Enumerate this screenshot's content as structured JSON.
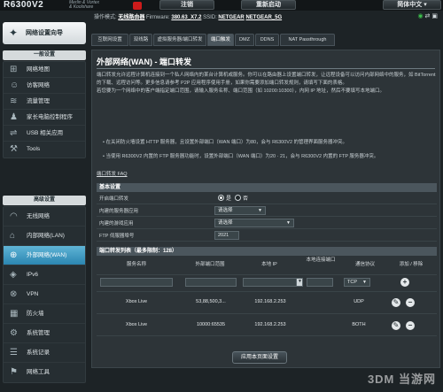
{
  "brand": "R6300V2",
  "header": {
    "mascot_line1": "Merlin & Vortex",
    "mascot_line2": "& Koolshare",
    "btn_logout": "注销",
    "btn_reboot": "重新启动",
    "btn_lang": "简体中文",
    "status_prefix": "操作模式:",
    "mode": "无线路由器",
    "firmware_label": "Firmware:",
    "firmware": "380.63_X7.2",
    "ssid_label": "SSID:",
    "ssid1": "NETGEAR",
    "ssid2": "NETGEAR_5G"
  },
  "sidebar": {
    "quick_setup": "网络设置向导",
    "general_title": "一般设置",
    "general_items": [
      {
        "label": "网络地图",
        "icon": "map-icon"
      },
      {
        "label": "访客网络",
        "icon": "guest-icon"
      },
      {
        "label": "流量管理",
        "icon": "traffic-icon"
      },
      {
        "label": "家长电脑控制程序",
        "icon": "parental-icon"
      },
      {
        "label": "USB 相关应用",
        "icon": "usb-icon"
      },
      {
        "label": "Tools",
        "icon": "tools-icon"
      }
    ],
    "advanced_title": "高级设置",
    "advanced_items": [
      {
        "label": "无线网络",
        "icon": "wifi-icon"
      },
      {
        "label": "内部网络(LAN)",
        "icon": "home-icon"
      },
      {
        "label": "外部网络(WAN)",
        "icon": "globe-icon"
      },
      {
        "label": "IPv6",
        "icon": "ipv6-icon"
      },
      {
        "label": "VPN",
        "icon": "vpn-icon"
      },
      {
        "label": "防火墙",
        "icon": "firewall-icon"
      },
      {
        "label": "系统管理",
        "icon": "admin-icon"
      },
      {
        "label": "系统记录",
        "icon": "log-icon"
      },
      {
        "label": "网络工具",
        "icon": "network-tools-icon"
      }
    ]
  },
  "tabs": [
    "互联网设置",
    "双线路",
    "虚拟服务器/端口转发",
    "端口触发",
    "DMZ",
    "DDNS",
    "NAT Passthrough"
  ],
  "page": {
    "title": "外部网络(WAN) - 端口转发",
    "desc": "端口转发允许远程计算机连接到一个私人网络内的某台计算机或服务。你可以在路由器上设置端口转发，让远程设备可以访问内部网络中的服务，如 BitTorrent 的下载、远程访问等。更多信息请参考 P2P 应用程序使用手册，如果你需要添加端口转发规则，请填写下面的表格。",
    "desc2": "若您要为一个网络中的客户端指定端口范围，请输入服务名称、端口范围（如 10200:10300），内网 IP 地址，然后不要填写本地端口。",
    "bullet1": "在关闭防火墙设置 HTTP 服务器，且设置外部端口（WAN 端口）为80，会与 R6300V2 的管理界面服务器冲突。",
    "bullet2": "当使用 R6300V2 内置的 FTP 服务器功能时，设置外部端口（WAN 端口）为20 · 21，会与 R6300V2 内置的 FTP 服务器冲突。",
    "faq": "端口转发 FAQ"
  },
  "basic": {
    "header": "基本设置",
    "enable_label": "开启端口转发",
    "yes": "是",
    "no": "否",
    "server_list_label": "内建的服务器应用",
    "server_list_value": "请选择",
    "game_list_label": "内建的游戏应用",
    "game_list_value": "请选择",
    "ftp_label": "FTP 伺服器埠号",
    "ftp_value": "2021"
  },
  "rules": {
    "header": "端口转发列表（最多限制：128）",
    "col_service": "服务名称",
    "col_ext": "外部端口范围",
    "col_ip": "本地 IP",
    "col_local": "本地连接端口",
    "col_proto": "通信协议",
    "col_action": "添加 / 移除",
    "new_proto": "TCP",
    "rows": [
      {
        "service": "Xbox Live",
        "ext": "53,88,500,3...",
        "ip": "192.168.2.253",
        "local": "",
        "proto": "UDP"
      },
      {
        "service": "Xbox Live",
        "ext": "10000:65535",
        "ip": "192.168.2.253",
        "local": "",
        "proto": "BOTH"
      }
    ]
  },
  "apply": "应用本页面设置",
  "watermark": "3DM 当游网"
}
